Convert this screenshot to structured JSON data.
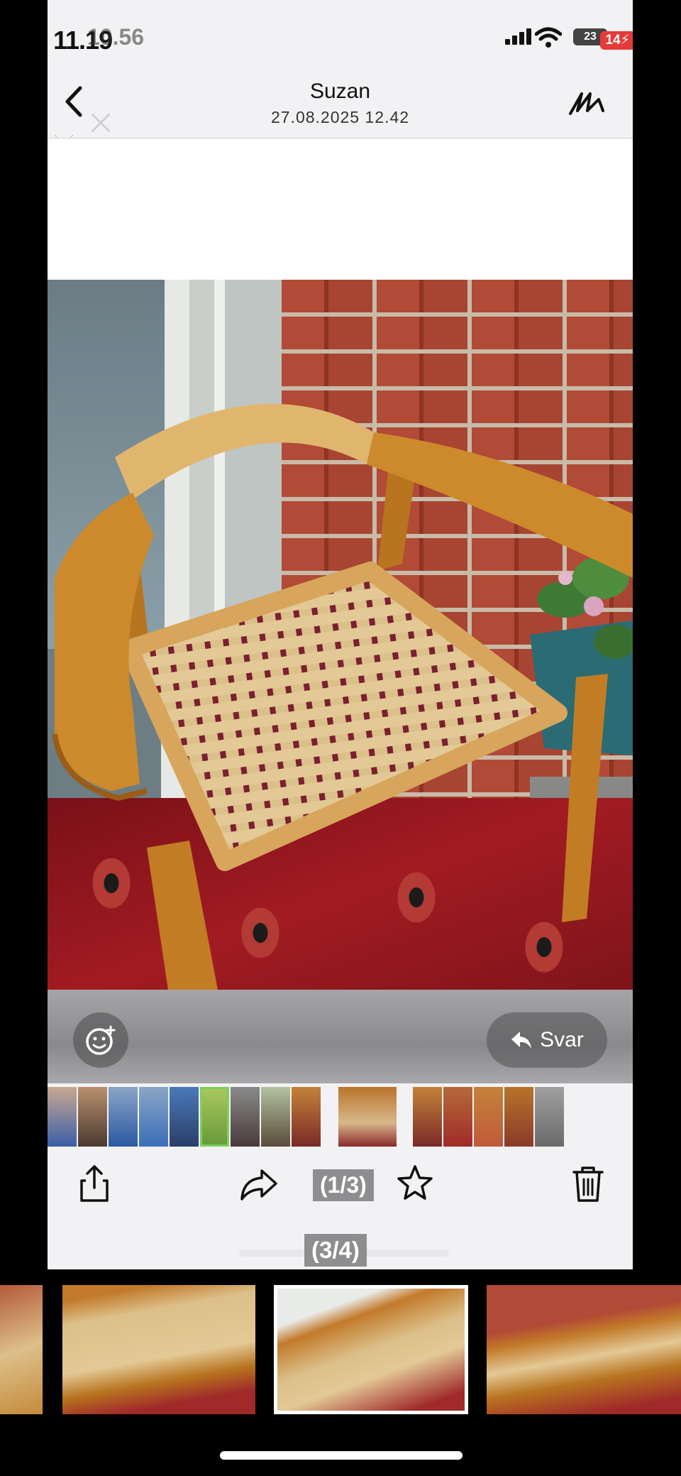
{
  "status_bar": {
    "time": "11.19",
    "time_overlay": "10.56",
    "battery_inner": "23",
    "battery_outer": "14"
  },
  "header": {
    "contact_name": "Suzan",
    "timestamp": "27.08.2025 12.42"
  },
  "reply_bar": {
    "reply_label": "Svar"
  },
  "toolbar": {
    "counter_inner": "(1/3)",
    "counter_outer": "(3/4)"
  },
  "icons": {
    "back": "chevron-left-icon",
    "markup": "markup-pen-icon",
    "close": "close-icon",
    "emoji": "emoji-add-icon",
    "reply": "reply-arrow-icon",
    "share": "share-icon",
    "forward": "forward-icon",
    "favorite": "star-icon",
    "delete": "trash-icon"
  },
  "colors": {
    "accent_battery": "#e53a3a",
    "background": "#f2f2f4"
  }
}
